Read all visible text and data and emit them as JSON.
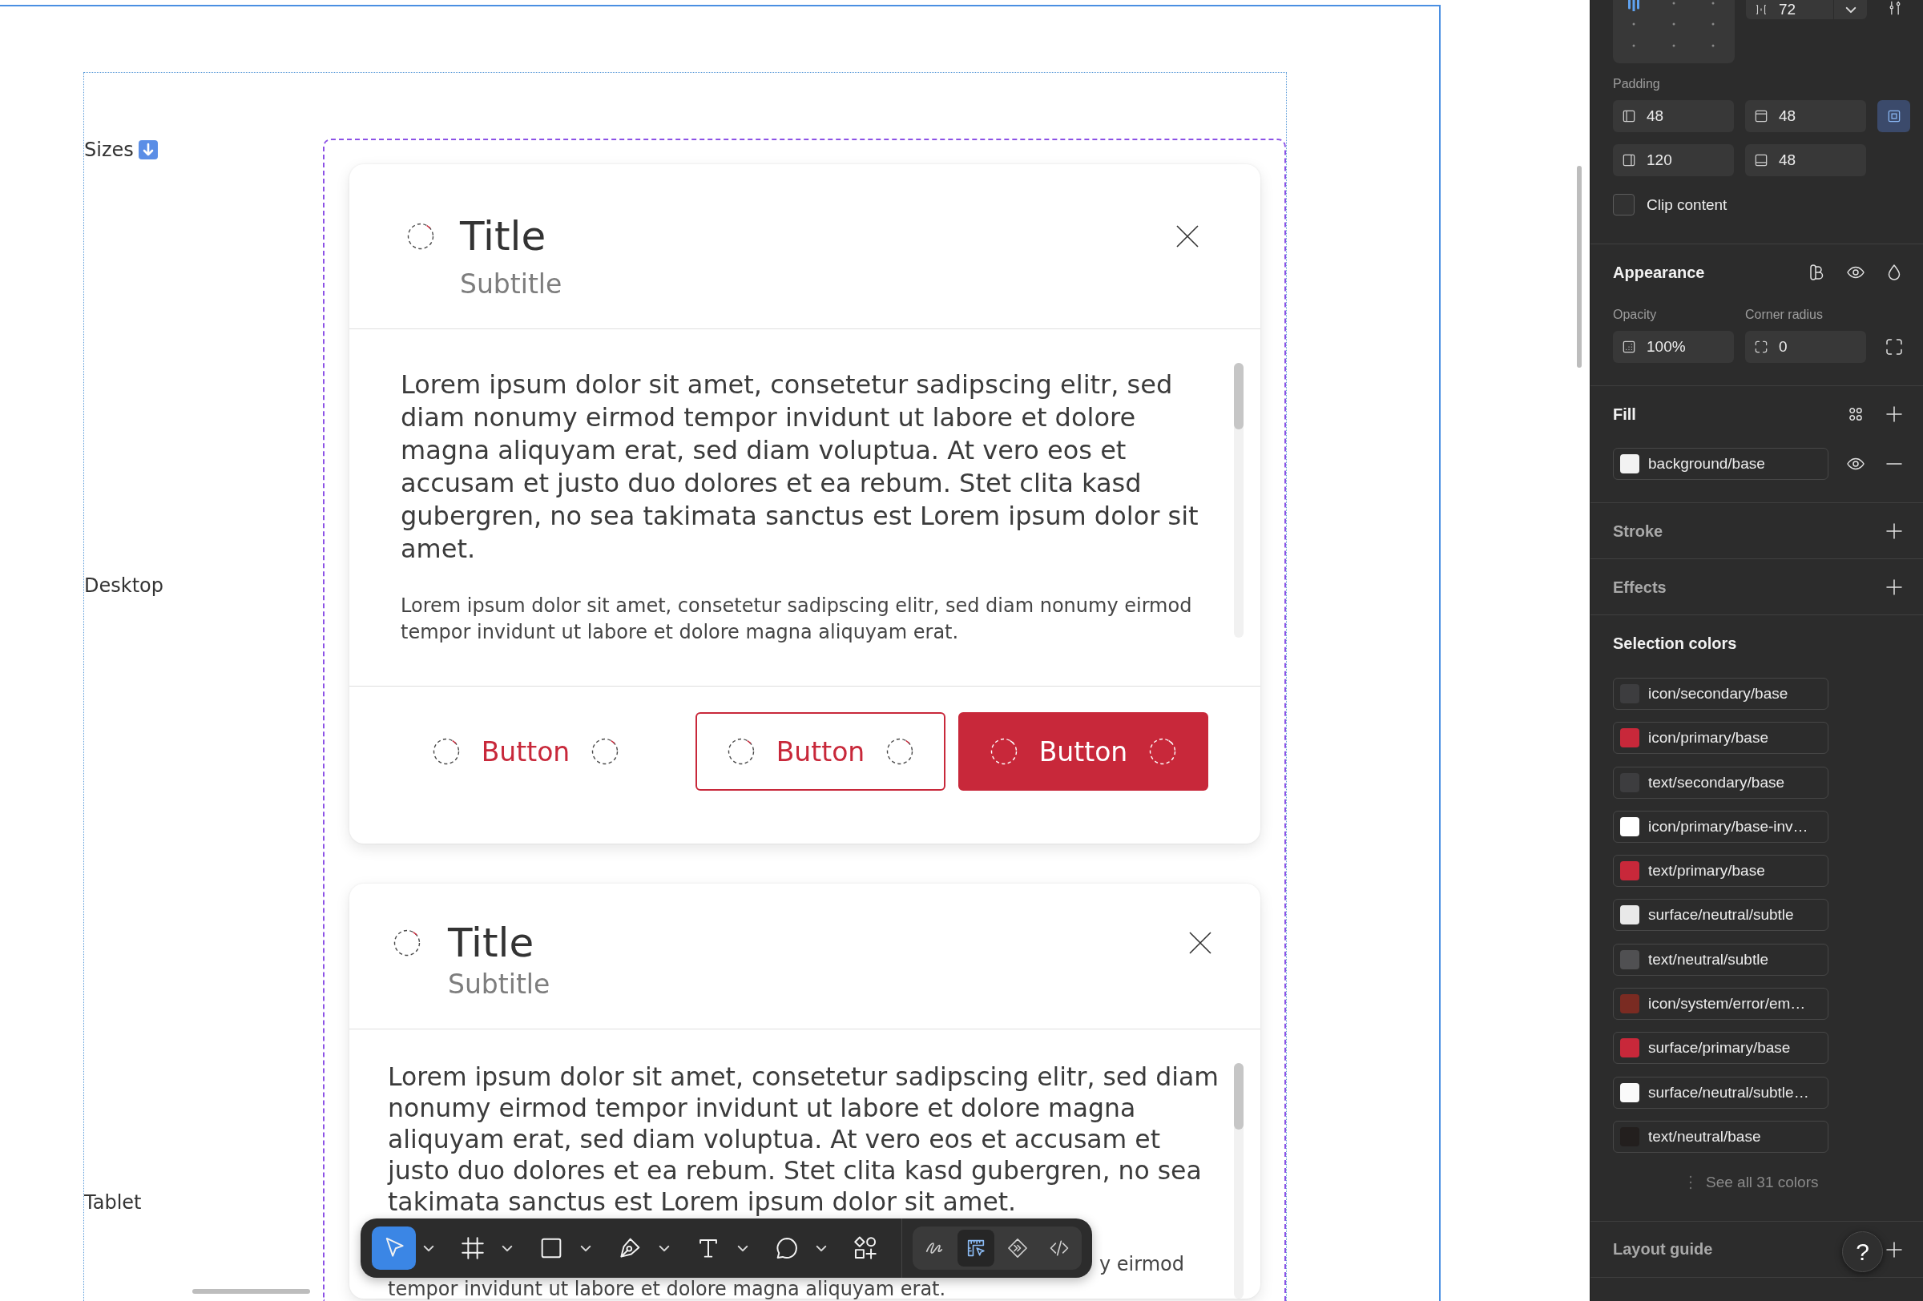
{
  "canvas": {
    "section_label": "Sizes",
    "variants": [
      {
        "kind": "desktop",
        "label": "Desktop",
        "card": {
          "title": "Title",
          "subtitle": "Subtitle",
          "paragraphs": [
            {
              "kind": "lead",
              "text": "Lorem ipsum dolor sit amet, consetetur sadipscing elitr, sed diam nonumy eirmod tempor invidunt ut labore et dolore magna aliquyam erat, sed diam voluptua. At vero eos et accusam et justo duo dolores et ea rebum. Stet clita kasd gubergren, no sea takimata sanctus est Lorem ipsum dolor sit amet."
            },
            {
              "kind": "body",
              "text": "Lorem ipsum dolor sit amet, consetetur sadipscing elitr, sed diam nonumy eirmod tempor invidunt ut labore et dolore magna aliquyam erat."
            }
          ],
          "buttons": [
            {
              "kind": "ghost",
              "label": "Button"
            },
            {
              "kind": "outline",
              "label": "Button"
            },
            {
              "kind": "filled",
              "label": "Button"
            }
          ]
        }
      },
      {
        "kind": "tablet",
        "label": "Tablet",
        "card": {
          "title": "Title",
          "subtitle": "Subtitle",
          "paragraphs": [
            {
              "kind": "lead",
              "text": "Lorem ipsum dolor sit amet, consetetur sadipscing elitr, sed diam nonumy eirmod tempor invidunt ut labore et dolore magna aliquyam erat, sed diam voluptua. At vero eos et accusam et justo duo dolores et ea rebum. Stet clita kasd gubergren, no sea takimata sanctus est Lorem ipsum dolor sit amet."
            },
            {
              "kind": "covered",
              "lines": [
                "y eirmod",
                "tempor invidunt ut labore et dolore magna aliquyam erat."
              ]
            }
          ]
        }
      }
    ]
  },
  "toolbar": {
    "tools": [
      {
        "kind": "move",
        "selected": true,
        "menu": true
      },
      {
        "kind": "frame",
        "selected": false,
        "menu": true
      },
      {
        "kind": "rectangle",
        "selected": false,
        "menu": true
      },
      {
        "kind": "pen",
        "selected": false,
        "menu": true
      },
      {
        "kind": "text",
        "selected": false,
        "menu": true
      },
      {
        "kind": "comment",
        "selected": false,
        "menu": true
      },
      {
        "kind": "actions",
        "selected": false,
        "menu": false
      }
    ],
    "modes": [
      {
        "kind": "draw",
        "selected": false
      },
      {
        "kind": "dev",
        "selected": true
      },
      {
        "kind": "component",
        "selected": false
      },
      {
        "kind": "code",
        "selected": false
      }
    ]
  },
  "properties_panel": {
    "auto_layout": {
      "gap": "72"
    },
    "padding": {
      "label": "Padding",
      "fields": [
        {
          "kind": "left",
          "value": "48"
        },
        {
          "kind": "top",
          "value": "48"
        },
        {
          "kind": "right",
          "value": "120"
        },
        {
          "kind": "bottom",
          "value": "48"
        }
      ],
      "individual_sides": {
        "on": true
      }
    },
    "clip_content": {
      "label": "Clip content",
      "checked": false
    },
    "appearance": {
      "title": "Appearance",
      "empty": false,
      "opacity": {
        "label": "Opacity",
        "value": "100%"
      },
      "corner_radius": {
        "label": "Corner radius",
        "value": "0"
      }
    },
    "fill": {
      "title": "Fill",
      "empty": false,
      "items": [
        {
          "name": "background/base",
          "color": "#f2f2f2",
          "visible": true
        }
      ]
    },
    "stroke": {
      "title": "Stroke",
      "empty": true
    },
    "effects": {
      "title": "Effects",
      "empty": true
    },
    "selection_colors": {
      "title": "Selection colors",
      "empty": false,
      "items": [
        {
          "name": "icon/secondary/base",
          "color": "#3d3d3f"
        },
        {
          "name": "icon/primary/base",
          "color": "#c8283a"
        },
        {
          "name": "text/secondary/base",
          "color": "#3d3d3f"
        },
        {
          "name": "icon/primary/base-inv…",
          "color": "#ffffff"
        },
        {
          "name": "text/primary/base",
          "color": "#c8283a"
        },
        {
          "name": "surface/neutral/subtle",
          "color": "#e9e9e9"
        },
        {
          "name": "text/neutral/subtle",
          "color": "#505052"
        },
        {
          "name": "icon/system/error/em…",
          "color": "#7a2b22"
        },
        {
          "name": "surface/primary/base",
          "color": "#c8283a"
        },
        {
          "name": "surface/neutral/subtle…",
          "color": "#fafafa"
        },
        {
          "name": "text/neutral/base",
          "color": "#231f1e"
        }
      ],
      "see_all": "See all 31 colors"
    },
    "layout_guide": {
      "title": "Layout guide",
      "empty": true
    },
    "help_button": {
      "label": "?"
    }
  }
}
